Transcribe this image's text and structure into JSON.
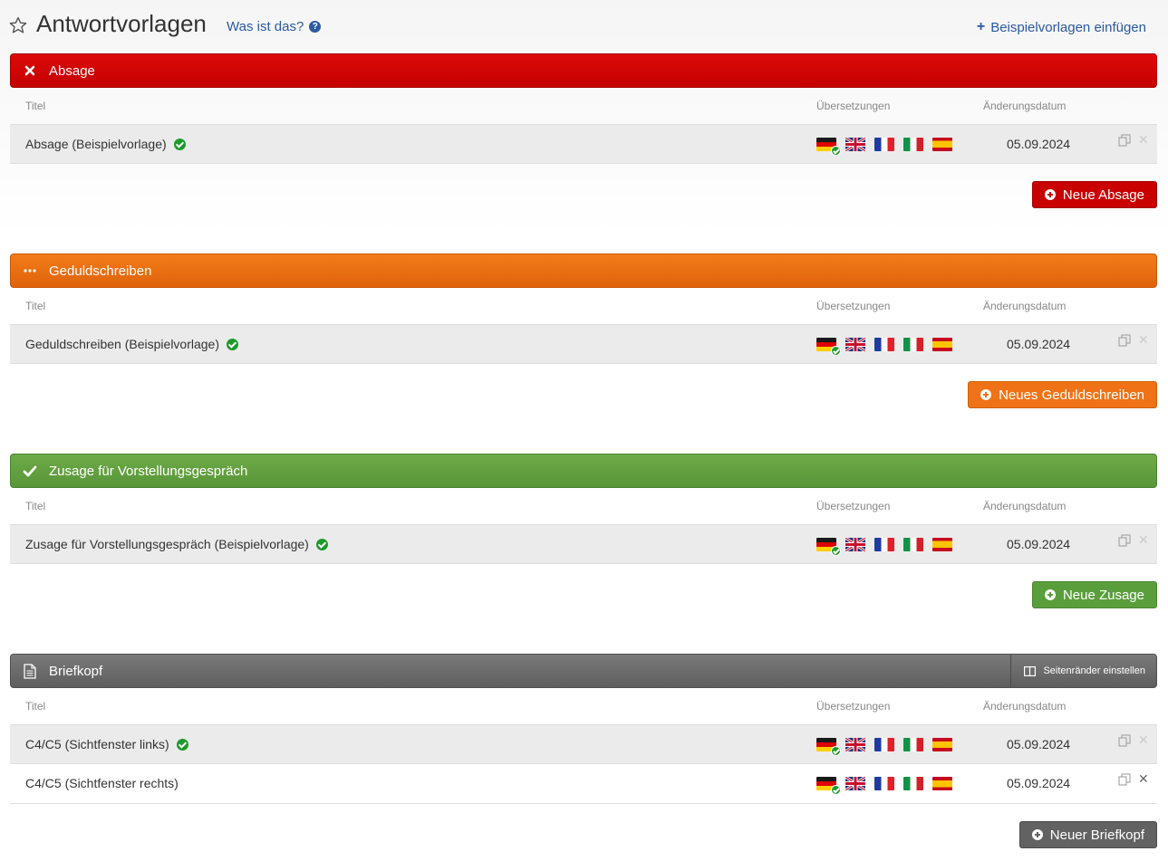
{
  "header": {
    "title": "Antwortvorlagen",
    "help_link": "Was ist das?",
    "help_icon": "?",
    "insert_link": "Beispielvorlagen einfügen",
    "insert_icon": "+"
  },
  "columns": {
    "title": "Titel",
    "translations": "Übersetzungen",
    "date": "Änderungsdatum"
  },
  "sections": [
    {
      "name": "Absage",
      "icon": "close-icon",
      "color": "#d20000",
      "add_button": "Neue Absage",
      "rows": [
        {
          "title": "Absage (Beispielvorlage)",
          "verified": true,
          "date": "05.09.2024"
        }
      ]
    },
    {
      "name": "Geduldschreiben",
      "icon": "ellipsis-icon",
      "color": "#ec6e12",
      "add_button": "Neues Geduldschreiben",
      "rows": [
        {
          "title": "Geduldschreiben (Beispielvorlage)",
          "verified": true,
          "date": "05.09.2024"
        }
      ]
    },
    {
      "name": "Zusage für Vorstellungsgespräch",
      "icon": "checkmark-icon",
      "color": "#62a040",
      "add_button": "Neue Zusage",
      "rows": [
        {
          "title": "Zusage für Vorstellungsgespräch (Beispielvorlage)",
          "verified": true,
          "date": "05.09.2024"
        }
      ]
    },
    {
      "name": "Briefkopf",
      "icon": "document-icon",
      "color": "#6a6a6a",
      "extra_button": "Seitenränder einstellen",
      "add_button": "Neuer Briefkopf",
      "rows": [
        {
          "title": "C4/C5 (Sichtfenster links)",
          "verified": true,
          "date": "05.09.2024"
        },
        {
          "title": "C4/C5 (Sichtfenster rechts)",
          "verified": false,
          "date": "05.09.2024"
        }
      ]
    }
  ],
  "flags": [
    "de-flag-icon",
    "gb-flag-icon",
    "fr-flag-icon",
    "it-flag-icon",
    "es-flag-icon"
  ]
}
